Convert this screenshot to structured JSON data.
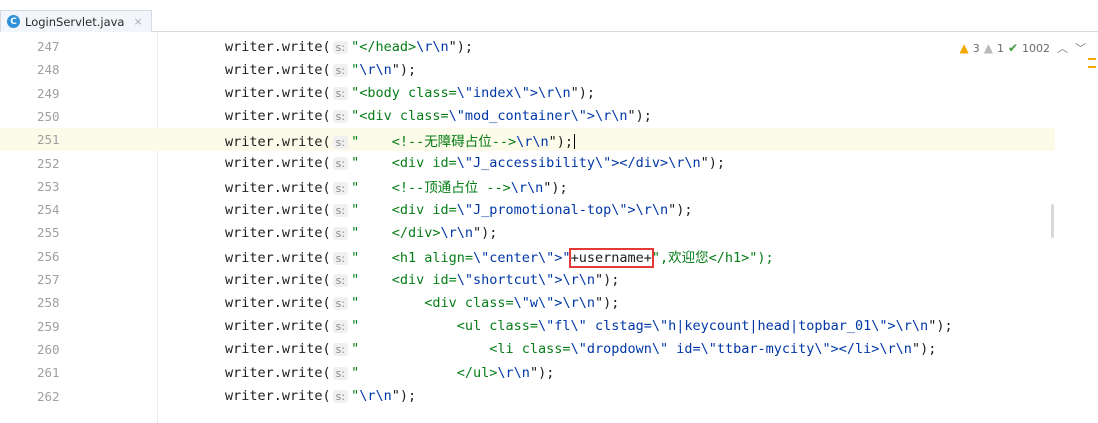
{
  "tab": {
    "icon_letter": "C",
    "title": "LoginServlet.java",
    "close_glyph": "×"
  },
  "inspections": {
    "warnings": "3",
    "weak_warnings": "1",
    "ok_count": "1002",
    "up_icon": "chevron-up-icon",
    "down_icon": "chevron-down-icon"
  },
  "editor": {
    "hint_label": "s:",
    "current_line": "251",
    "lines": [
      {
        "no": "247",
        "prefix": "writer.write(",
        "str": "\"</head>",
        "esc": "\\r\\n",
        "end": "\");"
      },
      {
        "no": "248",
        "prefix": "writer.write(",
        "str": "\"",
        "esc": "\\r\\n",
        "end": "\");"
      },
      {
        "no": "249",
        "prefix": "writer.write(",
        "str": "\"<body class=",
        "esc": "\\\"index\\\">\\r\\n",
        "end": "\");"
      },
      {
        "no": "250",
        "prefix": "writer.write(",
        "str": "\"<div class=",
        "esc": "\\\"mod_container\\\">\\r\\n",
        "end": "\");"
      },
      {
        "no": "251",
        "prefix": "writer.write(",
        "str": "\"    <!--无障碍占位-->",
        "esc": "\\r\\n",
        "end": "\");"
      },
      {
        "no": "252",
        "prefix": "writer.write(",
        "str": "\"    <div id=",
        "esc": "\\\"J_accessibility\\\"></div>\\r\\n",
        "end": "\");"
      },
      {
        "no": "253",
        "prefix": "writer.write(",
        "str": "\"    <!--顶通占位 -->",
        "esc": "\\r\\n",
        "end": "\");"
      },
      {
        "no": "254",
        "prefix": "writer.write(",
        "str": "\"    <div id=",
        "esc": "\\\"J_promotional-top\\\">\\r\\n",
        "end": "\");"
      },
      {
        "no": "255",
        "prefix": "writer.write(",
        "str": "\"    </div>",
        "esc": "\\r\\n",
        "end": "\");"
      },
      {
        "no": "256",
        "prefix": "writer.write(",
        "str": "\"    <h1 align=",
        "esc": "\\\"center\\\">\"",
        "boxed": "+username+",
        "tail": "\",欢迎您</h1>\");"
      },
      {
        "no": "257",
        "prefix": "writer.write(",
        "str": "\"    <div id=",
        "esc": "\\\"shortcut\\\">\\r\\n",
        "end": "\");"
      },
      {
        "no": "258",
        "prefix": "writer.write(",
        "str": "\"        <div class=",
        "esc": "\\\"w\\\">\\r\\n",
        "end": "\");"
      },
      {
        "no": "259",
        "prefix": "writer.write(",
        "str": "\"            <ul class=",
        "esc": "\\\"fl\\\" clstag=\\\"h|keycount|head|topbar_01\\\">\\r\\n",
        "end": "\");"
      },
      {
        "no": "260",
        "prefix": "writer.write(",
        "str": "\"                <li class=",
        "esc": "\\\"dropdown\\\" id=\\\"ttbar-mycity\\\"></li>\\r\\n",
        "end": "\");"
      },
      {
        "no": "261",
        "prefix": "writer.write(",
        "str": "\"            </ul>",
        "esc": "\\r\\n",
        "end": "\");"
      },
      {
        "no": "262",
        "prefix": "writer.write(",
        "str": "\"",
        "esc": "\\r\\n",
        "end": "\");"
      }
    ]
  }
}
